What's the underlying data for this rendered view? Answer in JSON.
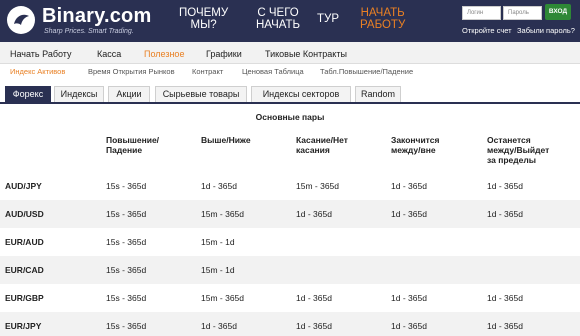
{
  "header": {
    "logo_name": "Binary.com",
    "logo_tagline": "Sharp Prices. Smart Trading.",
    "nav": [
      {
        "line1": "ПОЧЕМУ",
        "line2": "МЫ?"
      },
      {
        "line1": "С ЧЕГО",
        "line2": "НАЧАТЬ"
      },
      {
        "line1": "ТУР",
        "line2": ""
      },
      {
        "line1": "НАЧАТЬ",
        "line2": "РАБОТУ"
      }
    ],
    "login_placeholder": "Логин",
    "password_placeholder": "Пароль",
    "login_button": "ВХОД",
    "open_account": "Откройте счет",
    "forgot_password": "Забыли пароль?"
  },
  "menu": [
    "Начать Работу",
    "Касса",
    "Полезное",
    "Графики",
    "Тиковые Контракты"
  ],
  "submenu": [
    "Индекс Активов",
    "Время Открытия Рынков",
    "Контракт",
    "Ценовая Таблица",
    "Табл.Повышение/Падение"
  ],
  "tabs": [
    "Форекс",
    "Индексы",
    "Акции",
    "Сырьевые товары",
    "Индексы секторов",
    "Random"
  ],
  "table": {
    "section_title": "Основные пары",
    "columns": [
      {
        "l1": "Повышение/",
        "l2": "Падение",
        "l3": ""
      },
      {
        "l1": "Выше/Ниже",
        "l2": "",
        "l3": ""
      },
      {
        "l1": "Касание/Нет",
        "l2": "касания",
        "l3": ""
      },
      {
        "l1": "Закончится",
        "l2": "между/вне",
        "l3": ""
      },
      {
        "l1": "Останется",
        "l2": "между/Выйдет",
        "l3": "за пределы"
      }
    ],
    "rows": [
      {
        "symbol": "AUD/JPY",
        "cells": [
          "15s - 365d",
          "1d - 365d",
          "15m - 365d",
          "1d - 365d",
          "1d - 365d"
        ]
      },
      {
        "symbol": "AUD/USD",
        "cells": [
          "15s - 365d",
          "15m - 365d",
          "1d - 365d",
          "1d - 365d",
          "1d - 365d"
        ]
      },
      {
        "symbol": "EUR/AUD",
        "cells": [
          "15s - 365d",
          "15m - 1d",
          "",
          "",
          ""
        ]
      },
      {
        "symbol": "EUR/CAD",
        "cells": [
          "15s - 365d",
          "15m - 1d",
          "",
          "",
          ""
        ]
      },
      {
        "symbol": "EUR/GBP",
        "cells": [
          "15s - 365d",
          "15m - 365d",
          "1d - 365d",
          "1d - 365d",
          "1d - 365d"
        ]
      },
      {
        "symbol": "EUR/JPY",
        "cells": [
          "15s - 365d",
          "1d - 365d",
          "1d - 365d",
          "1d - 365d",
          "1d - 365d"
        ]
      }
    ]
  }
}
